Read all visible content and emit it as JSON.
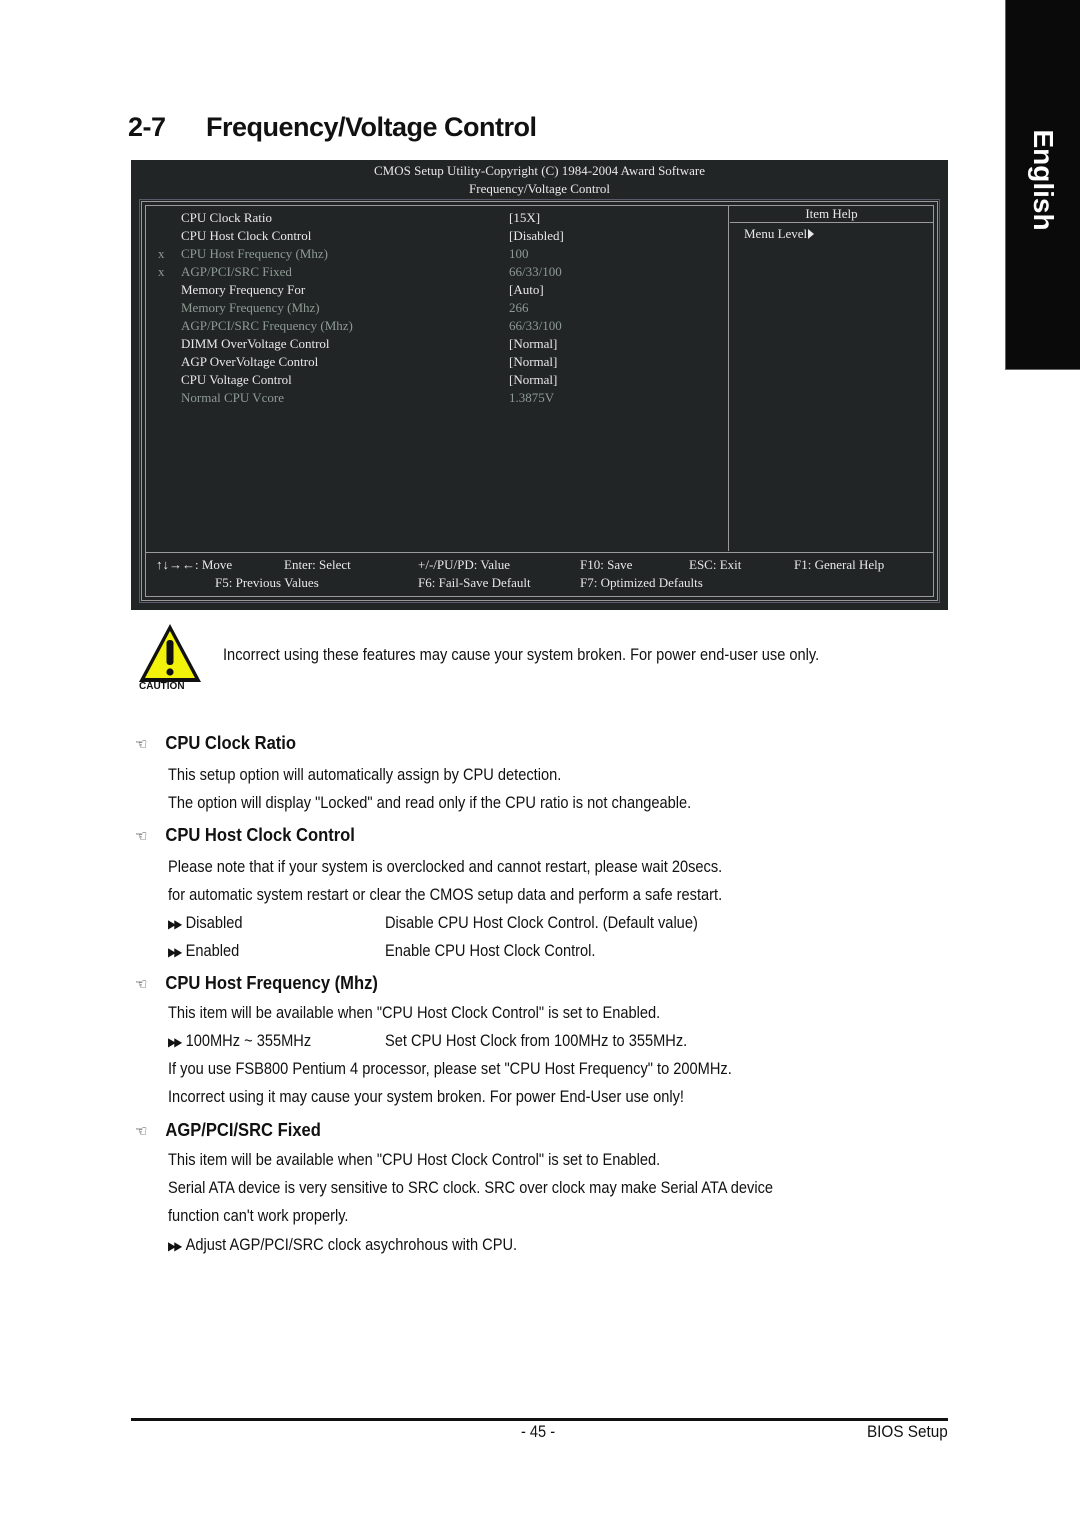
{
  "side_tab": {
    "label": "English"
  },
  "title": {
    "number": "2-7",
    "text": "Frequency/Voltage Control"
  },
  "bios": {
    "header_line1": "CMOS Setup Utility-Copyright (C) 1984-2004 Award Software",
    "header_line2": "Frequency/Voltage Control",
    "items": [
      {
        "mark": "",
        "label": "CPU Clock Ratio",
        "value": "[15X]",
        "enabled": true
      },
      {
        "mark": "",
        "label": "CPU Host Clock Control",
        "value": "[Disabled]",
        "enabled": true
      },
      {
        "mark": "x",
        "label": "CPU Host Frequency (Mhz)",
        "value": "100",
        "enabled": false
      },
      {
        "mark": "x",
        "label": "AGP/PCI/SRC Fixed",
        "value": "66/33/100",
        "enabled": false
      },
      {
        "mark": "",
        "label": "Memory Frequency For",
        "value": "[Auto]",
        "enabled": true
      },
      {
        "mark": "",
        "label": "Memory Frequency (Mhz)",
        "value": "266",
        "enabled": false
      },
      {
        "mark": "",
        "label": "AGP/PCI/SRC Frequency (Mhz)",
        "value": "66/33/100",
        "enabled": false
      },
      {
        "mark": "",
        "label": "DIMM OverVoltage Control",
        "value": "[Normal]",
        "enabled": true
      },
      {
        "mark": "",
        "label": "AGP OverVoltage Control",
        "value": "[Normal]",
        "enabled": true
      },
      {
        "mark": "",
        "label": "CPU Voltage Control",
        "value": "[Normal]",
        "enabled": true
      },
      {
        "mark": "",
        "label": "Normal CPU Vcore",
        "value": "1.3875V",
        "enabled": false
      }
    ],
    "help": {
      "title": "Item Help",
      "menu_level": "Menu Level"
    },
    "keys": {
      "move": "↑↓→←: Move",
      "select": "Enter: Select",
      "value": "+/-/PU/PD: Value",
      "save": "F10: Save",
      "exit": "ESC: Exit",
      "help": "F1: General Help",
      "previous": "F5: Previous Values",
      "failsafe": "F6: Fail-Save Default",
      "optimized": "F7: Optimized Defaults"
    }
  },
  "caution": {
    "label": "CAUTION",
    "text": "Incorrect using these features may cause your system broken. For power end-user use only."
  },
  "sections": [
    {
      "heading": "CPU Clock Ratio",
      "lines": [
        "This setup option will automatically assign by CPU detection.",
        "The option will display \"Locked\" and read only if the CPU ratio is not changeable."
      ]
    },
    {
      "heading": "CPU Host Clock Control",
      "lines": [
        "Please note that if your system is overclocked and cannot restart, please wait 20secs.",
        "for automatic system restart or clear the CMOS setup data and perform a safe restart."
      ],
      "options": [
        {
          "key": "Disabled",
          "desc": "Disable CPU Host Clock Control. (Default value)"
        },
        {
          "key": "Enabled",
          "desc": "Enable CPU Host Clock Control."
        }
      ]
    },
    {
      "heading": "CPU Host Frequency (Mhz)",
      "lines": [
        "This item will be available when \"CPU Host Clock Control\" is set to Enabled."
      ],
      "options": [
        {
          "key": "100MHz ~ 355MHz",
          "desc": "Set CPU Host Clock from 100MHz to 355MHz."
        }
      ],
      "lines_after": [
        "If you use FSB800 Pentium 4 processor, please set \"CPU Host Frequency\" to 200MHz.",
        "Incorrect using it may cause your system broken. For power End-User use only!"
      ]
    },
    {
      "heading": "AGP/PCI/SRC Fixed",
      "lines": [
        "This item will be available when \"CPU Host Clock Control\" is set to Enabled.",
        "Serial ATA device is very sensitive to SRC clock. SRC over clock may make Serial ATA device",
        "function can't work properly."
      ],
      "options": [
        {
          "key": "Adjust AGP/PCI/SRC clock asychrohous with CPU.",
          "desc": ""
        }
      ]
    }
  ],
  "footer": {
    "page": "- 45 -",
    "title": "BIOS Setup"
  }
}
